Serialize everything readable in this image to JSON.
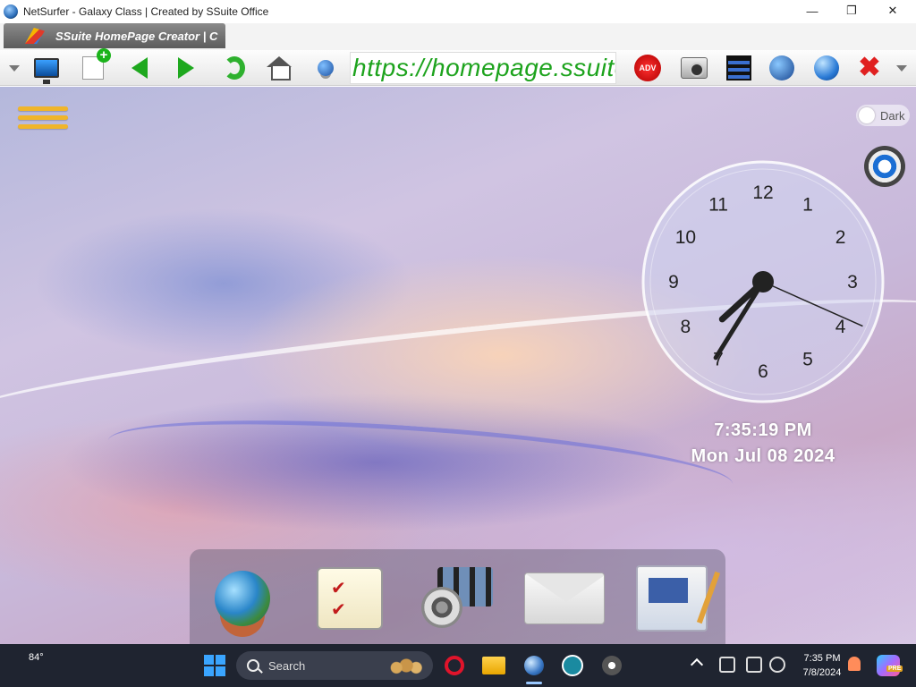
{
  "window": {
    "title": "NetSurfer - Galaxy Class | Created by SSuite Office",
    "min_symbol": "—",
    "max_symbol": "❐",
    "close_symbol": "✕"
  },
  "tab": {
    "label": "SSuite HomePage Creator | C"
  },
  "toolbar": {
    "url": "https://homepage.ssuiteoffice.com",
    "adv_label": "ADV",
    "icons": [
      "dropdown-icon",
      "monitor-icon",
      "new-page-icon",
      "back-arrow-icon",
      "forward-arrow-icon",
      "reload-icon",
      "home-icon",
      "globe-icon",
      "adv-icon",
      "camera-icon",
      "film-icon",
      "search-globe-icon",
      "blue-ball-icon",
      "stop-icon",
      "dropdown-icon"
    ]
  },
  "page": {
    "dark_toggle_label": "Dark",
    "clock": {
      "numbers": [
        "12",
        "1",
        "2",
        "3",
        "4",
        "5",
        "6",
        "7",
        "8",
        "9",
        "10",
        "11"
      ],
      "hour": 7,
      "minute": 35,
      "second": 19,
      "time": "7:35:19 PM",
      "date": "Mon Jul 08 2024"
    },
    "dock_items": [
      "globe-app-icon",
      "tasks-app-icon",
      "media-app-icon",
      "mail-app-icon",
      "news-app-icon"
    ]
  },
  "taskbar": {
    "weather": "84°",
    "search_label": "Search",
    "time": "7:35 PM",
    "date": "7/8/2024",
    "pre_label": "PRE"
  },
  "colors": {
    "url_green": "#1da31d",
    "hamburger": "#f0b52a",
    "taskbar_bg": "#1f2430"
  }
}
